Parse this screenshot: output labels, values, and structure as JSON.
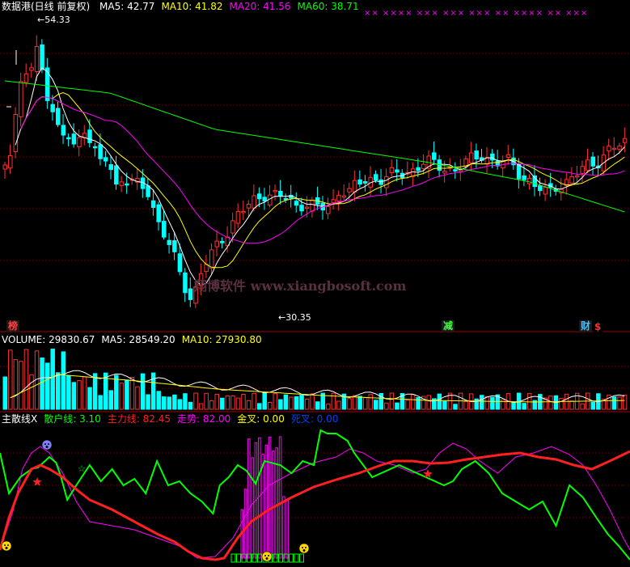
{
  "main_chart": {
    "title": "数据港(日线 前复权)",
    "indicators": [
      {
        "label": "MA5: 42.77",
        "color": "#ffffff"
      },
      {
        "label": "MA10: 41.82",
        "color": "#ffff00"
      },
      {
        "label": "MA20: 41.56",
        "color": "#ff00ff"
      },
      {
        "label": "MA60: 38.71",
        "color": "#00ff00"
      }
    ],
    "high_label": "54.33",
    "low_label": "30.35",
    "watermark": "翔博软件 www.xiangbosoft.com",
    "markers": [
      {
        "text": "榜",
        "color": "#ff4040",
        "bg": "#1a1a1a"
      },
      {
        "text": "减",
        "color": "#40ff40",
        "bg": "#1a1a1a"
      },
      {
        "text": "财",
        "color": "#40c0ff",
        "bg": "#1a1a1a"
      },
      {
        "text": "$",
        "color": "#ff3030",
        "bg": "#000000"
      }
    ],
    "top_x_marks": "×× ×××× ××× ××× ××× ×× ×××× ×× ×××"
  },
  "volume_panel": {
    "labels": [
      {
        "label": "VOLUME: 29830.67",
        "color": "#ffffff"
      },
      {
        "label": "MA5: 28549.20",
        "color": "#ffffff"
      },
      {
        "label": "MA10: 27930.80",
        "color": "#ffff00"
      }
    ]
  },
  "indicator_panel": {
    "labels": [
      {
        "label": "主散线X",
        "color": "#ffffff"
      },
      {
        "label": "散户线: 3.10",
        "color": "#00ff00"
      },
      {
        "label": "主力线: 82.45",
        "color": "#ff2020"
      },
      {
        "label": "走势: 82.00",
        "color": "#ff00ff"
      },
      {
        "label": "金叉: 0.00",
        "color": "#ffff00"
      },
      {
        "label": "死叉: 0.00",
        "color": "#0040ff"
      }
    ]
  },
  "colors": {
    "up": "#ff3030",
    "down": "#00ffff",
    "ma5": "#ffffff",
    "ma10": "#ffff00",
    "ma20": "#ff00ff",
    "ma60": "#00ff00",
    "grid": "#800000",
    "divider": "#a00000"
  }
}
